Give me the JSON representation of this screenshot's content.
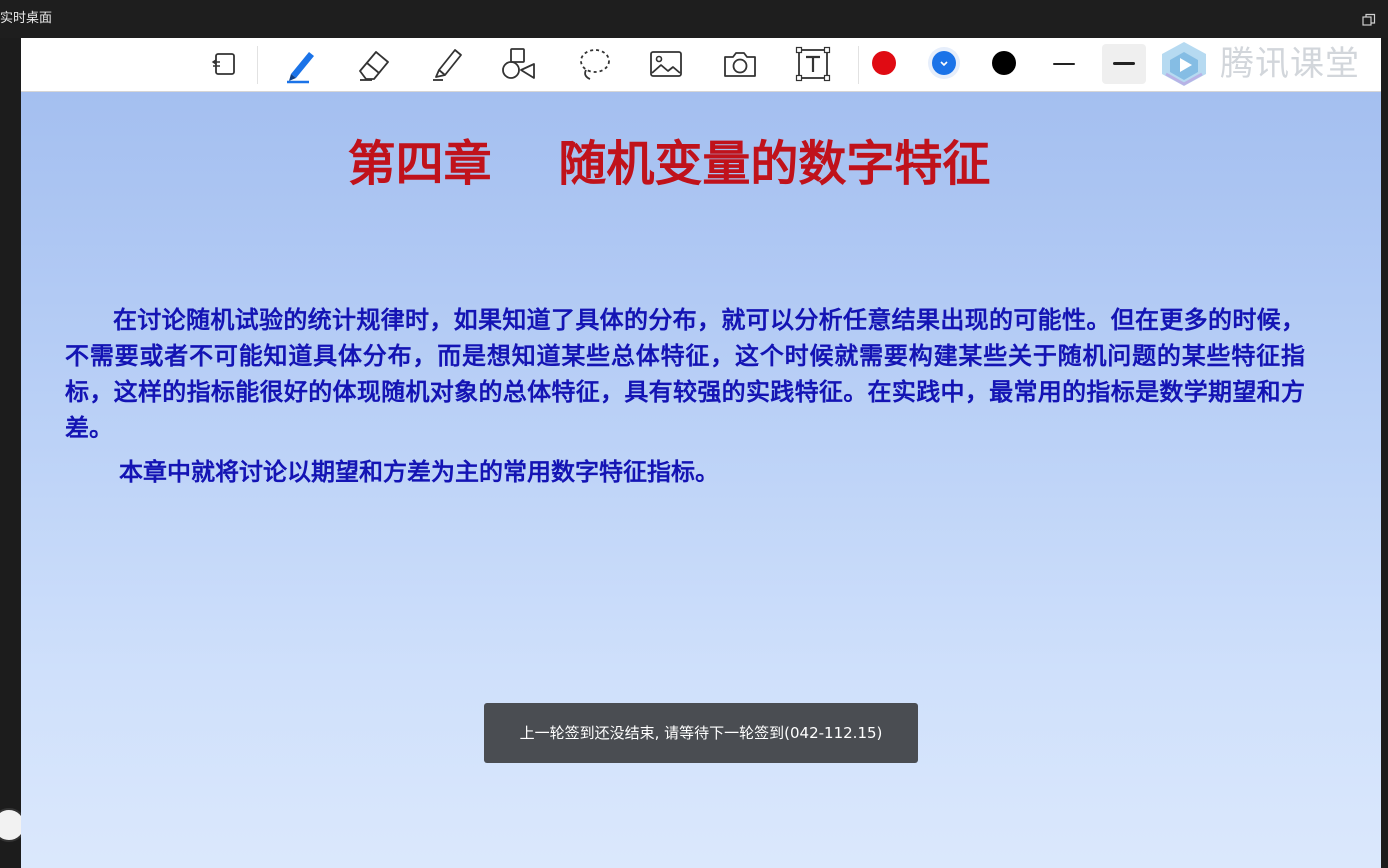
{
  "window": {
    "title": "实时桌面"
  },
  "toolbar": {
    "tools": [
      {
        "name": "page-switch-icon"
      },
      {
        "name": "pen-icon"
      },
      {
        "name": "eraser-icon"
      },
      {
        "name": "highlighter-icon"
      },
      {
        "name": "shapes-icon"
      },
      {
        "name": "lasso-icon"
      },
      {
        "name": "image-icon"
      },
      {
        "name": "camera-icon"
      },
      {
        "name": "text-icon"
      }
    ],
    "colors": {
      "red": "#e00b13",
      "blue": "#1b73e8",
      "black": "#000000"
    },
    "logo_text": "腾讯课堂"
  },
  "slide": {
    "title": "第四章    随机变量的数字特征",
    "paragraph1": "在讨论随机试验的统计规律时，如果知道了具体的分布，就可以分析任意结果出现的可能性。但在更多的时候，不需要或者不可能知道具体分布，而是想知道某些总体特征，这个时候就需要构建某些关于随机问题的某些特征指标，这样的指标能很好的体现随机对象的总体特征，具有较强的实践特征。在实践中，最常用的指标是数学期望和方差。",
    "paragraph2": "本章中就将讨论以期望和方差为主的常用数字特征指标。"
  },
  "toast": {
    "message": "上一轮签到还没结束, 请等待下一轮签到(042-112.15)"
  }
}
